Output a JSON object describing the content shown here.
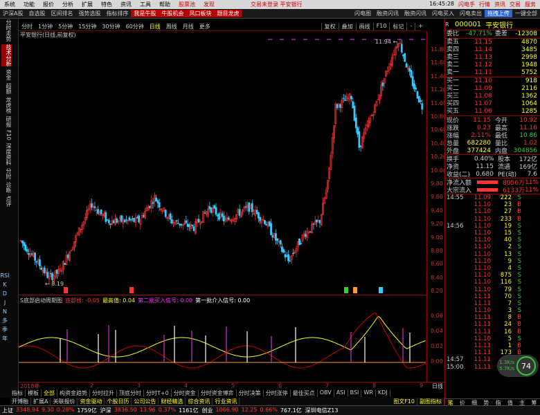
{
  "menu": {
    "items": [
      "系统",
      "功能",
      "报价",
      "分析",
      "扩展",
      "特色",
      "资讯",
      "工具",
      "帮助"
    ],
    "hot": "股票池",
    "sub": "发现",
    "center": [
      "交易未登录",
      "平安银行"
    ],
    "right": [
      "闪电手",
      "行情",
      "资讯",
      "交易",
      "服务"
    ],
    "time": "16:45:28"
  },
  "toolbar": {
    "items": [
      "沪深A股",
      "自选股",
      "区间排名",
      "强势选股",
      "指标排序"
    ],
    "red": [
      "我是牛股",
      "牛股机会",
      "风口板块",
      "题目龙虎"
    ],
    "right": [
      "闪电图",
      "融资闪讯",
      "融资闪讯",
      "闪电买入",
      "闪电卖出"
    ],
    "badge": "拖拽上传",
    "tail": "一键全部"
  },
  "leftnav": [
    "分时走势",
    "技术分析",
    "资金",
    "超额",
    "龙虎榜",
    "研报",
    "F10",
    "深度资料",
    "分时",
    "诊断",
    "点评"
  ],
  "leftnav2": [
    "RSI",
    "K",
    "D",
    "J",
    "N",
    "多",
    "季",
    "年"
  ],
  "period": {
    "items": [
      "分时",
      "1分钟",
      "5分钟",
      "15分钟",
      "30分钟",
      "60分钟",
      "日线",
      "周线",
      "月线",
      "更多"
    ],
    "active": "日线",
    "tools": [
      "复权",
      "叠加",
      "画线",
      "F10",
      "标记",
      "-",
      "+"
    ]
  },
  "chart_title": "平安银行(日线,前复权)",
  "chart_labels": {
    "high": "11.94",
    "low": "8.19"
  },
  "price_axis": [
    "11.80",
    "11.60",
    "11.40",
    "11.20",
    "11.00",
    "10.80",
    "10.60",
    "10.40",
    "10.20",
    "10.00",
    "9.80",
    "9.60",
    "9.40",
    "9.20",
    "9.00",
    "8.80",
    "8.60",
    "8.40",
    "8.20"
  ],
  "indicator": {
    "name": "S底部启动周期图",
    "items": [
      {
        "label": "底部线: -0.05",
        "color": "#f33"
      },
      {
        "label": "最高值: 0.04",
        "color": "#ff0"
      },
      {
        "label": "第二批买入信号: 0.00",
        "color": "#f3f"
      },
      {
        "label": "第一批介入信号: 0.00",
        "color": "#fff"
      }
    ]
  },
  "ind_axis": [
    "0.06",
    "0.04",
    "0.02",
    "0.00"
  ],
  "time_axis": [
    "2018年",
    "2",
    "3",
    "4",
    "5",
    "6",
    "7",
    "8",
    "9"
  ],
  "bottom_tabs": [
    "指标",
    "模板",
    "全部",
    "构资金趋势",
    "分时拉升",
    "顶底分时",
    "分时T+0",
    "分时资金",
    "分时资金博弈",
    "分时决策",
    "分时涨停",
    "最佳买点",
    "OBV",
    "ASI",
    "BSI",
    "WR",
    "KDJ"
  ],
  "func_bar": [
    "开博融",
    "扩展A",
    "关联报价",
    "资金驱动",
    "个股日历",
    "公司公告",
    "财经精选",
    "综合资讯",
    "行业资讯"
  ],
  "func_right": [
    "图文F10",
    "副图指标"
  ],
  "status": [
    {
      "label": "上证",
      "v": "3348.94",
      "c": "9.30",
      "p": "0.28%",
      "a": "1759亿"
    },
    {
      "label": "沪深",
      "v": "3836.50",
      "c": "13.96",
      "p": "0.37%",
      "a": "1161亿"
    },
    {
      "label": "创业",
      "v": "1066.90",
      "c": "12.25",
      "p": "0.66%",
      "a": "767.1亿"
    }
  ],
  "status_tail": "深圳电信Z13",
  "stock": {
    "code": "000001",
    "name": "平安银行",
    "wb_label": "委比",
    "wb": "-47.71%",
    "wc_label": "委差",
    "wc": "-12308"
  },
  "asks": [
    {
      "l": "卖五",
      "p": "11.15",
      "v": "4870"
    },
    {
      "l": "卖四",
      "p": "11.14",
      "v": "3485"
    },
    {
      "l": "卖三",
      "p": "11.13",
      "v": "2998"
    },
    {
      "l": "卖二",
      "p": "11.12",
      "v": "1948"
    },
    {
      "l": "卖一",
      "p": "11.11",
      "v": "5752"
    }
  ],
  "bids": [
    {
      "l": "买一",
      "p": "11.10",
      "v": "918"
    },
    {
      "l": "买二",
      "p": "11.09",
      "v": "2116"
    },
    {
      "l": "买三",
      "p": "11.08",
      "v": "1362"
    },
    {
      "l": "买四",
      "p": "11.07",
      "v": "1064"
    },
    {
      "l": "买五",
      "p": "11.06",
      "v": "1285"
    }
  ],
  "quote": [
    {
      "k": "现价",
      "v": "11.15",
      "k2": "今开",
      "v2": "10.92"
    },
    {
      "k": "涨跌",
      "v": "0.23",
      "k2": "最高",
      "v2": "11.16"
    },
    {
      "k": "涨幅",
      "v": "2.11%",
      "k2": "最低",
      "v2": "10.86"
    },
    {
      "k": "总量",
      "v": "682280",
      "k2": "量比",
      "v2": "1.02"
    },
    {
      "k": "外盘",
      "v": "377424",
      "k2": "内盘",
      "v2": "304856"
    }
  ],
  "quote2": [
    {
      "k": "换手",
      "v": "0.40%",
      "k2": "股本",
      "v2": "172亿"
    },
    {
      "k": "净资",
      "v": "11.15",
      "k2": "流通",
      "v2": "169亿"
    },
    {
      "k": "收益(二)",
      "v": "0.680",
      "k2": "PE(动)",
      "v2": "7.6"
    }
  ],
  "flow": [
    {
      "k": "净流入额",
      "v": "8056万",
      "p": "11%"
    },
    {
      "k": "大宗流入",
      "v": "6133万",
      "p": "11%"
    }
  ],
  "ticks": [
    {
      "t": "14:55",
      "p": "11.09",
      "v": "222",
      "s": "S"
    },
    {
      "t": "",
      "p": "11.10",
      "v": "23",
      "s": "B"
    },
    {
      "t": "",
      "p": "11.10",
      "v": "27",
      "s": "B"
    },
    {
      "t": "",
      "p": "11.10",
      "v": "233",
      "s": "B"
    },
    {
      "t": "14:56",
      "p": "11.10",
      "v": "19",
      "s": "S"
    },
    {
      "t": "",
      "p": "11.10",
      "v": "15",
      "s": "S"
    },
    {
      "t": "",
      "p": "11.10",
      "v": "40",
      "s": "S"
    },
    {
      "t": "",
      "p": "11.10",
      "v": "2",
      "s": "S"
    },
    {
      "t": "",
      "p": "11.10",
      "v": "13",
      "s": "S"
    },
    {
      "t": "",
      "p": "11.10",
      "v": "9",
      "s": "S"
    },
    {
      "t": "",
      "p": "11.10",
      "v": "4",
      "s": "S"
    },
    {
      "t": "",
      "p": "11.10",
      "v": "875",
      "s": "S"
    },
    {
      "t": "",
      "p": "11.10",
      "v": "116",
      "s": "S"
    },
    {
      "t": "",
      "p": "11.10",
      "v": "79",
      "s": "S"
    },
    {
      "t": "",
      "p": "11.11",
      "v": "70",
      "s": "S"
    },
    {
      "t": "",
      "p": "11.11",
      "v": "7",
      "s": "S"
    },
    {
      "t": "",
      "p": "11.10",
      "v": "3",
      "s": "S"
    },
    {
      "t": "",
      "p": "11.11",
      "v": "8",
      "s": "B"
    },
    {
      "t": "",
      "p": "11.11",
      "v": "24",
      "s": "B"
    },
    {
      "t": "",
      "p": "11.11",
      "v": "16",
      "s": "B"
    },
    {
      "t": "",
      "p": "11.10",
      "v": "5",
      "s": "S"
    },
    {
      "t": "",
      "p": "11.11",
      "v": "1",
      "s": "B"
    },
    {
      "t": "",
      "p": "11.11",
      "v": "173",
      "s": "B"
    },
    {
      "t": "14:57",
      "p": "11.11",
      "v": "5",
      "s": "B"
    },
    {
      "t": "15:00",
      "p": "11.11",
      "v": "6830",
      "s": "B"
    }
  ],
  "rp_tabs": [
    "笔",
    "价",
    "细",
    "势",
    "指",
    "值",
    "主",
    "筹"
  ],
  "badge": {
    "v": "74",
    "unit": "%",
    "up": "1.3K/s",
    "down": "5.7K/s"
  },
  "colors": {
    "up": "#f33",
    "down": "#3cf",
    "accent": "#900"
  }
}
